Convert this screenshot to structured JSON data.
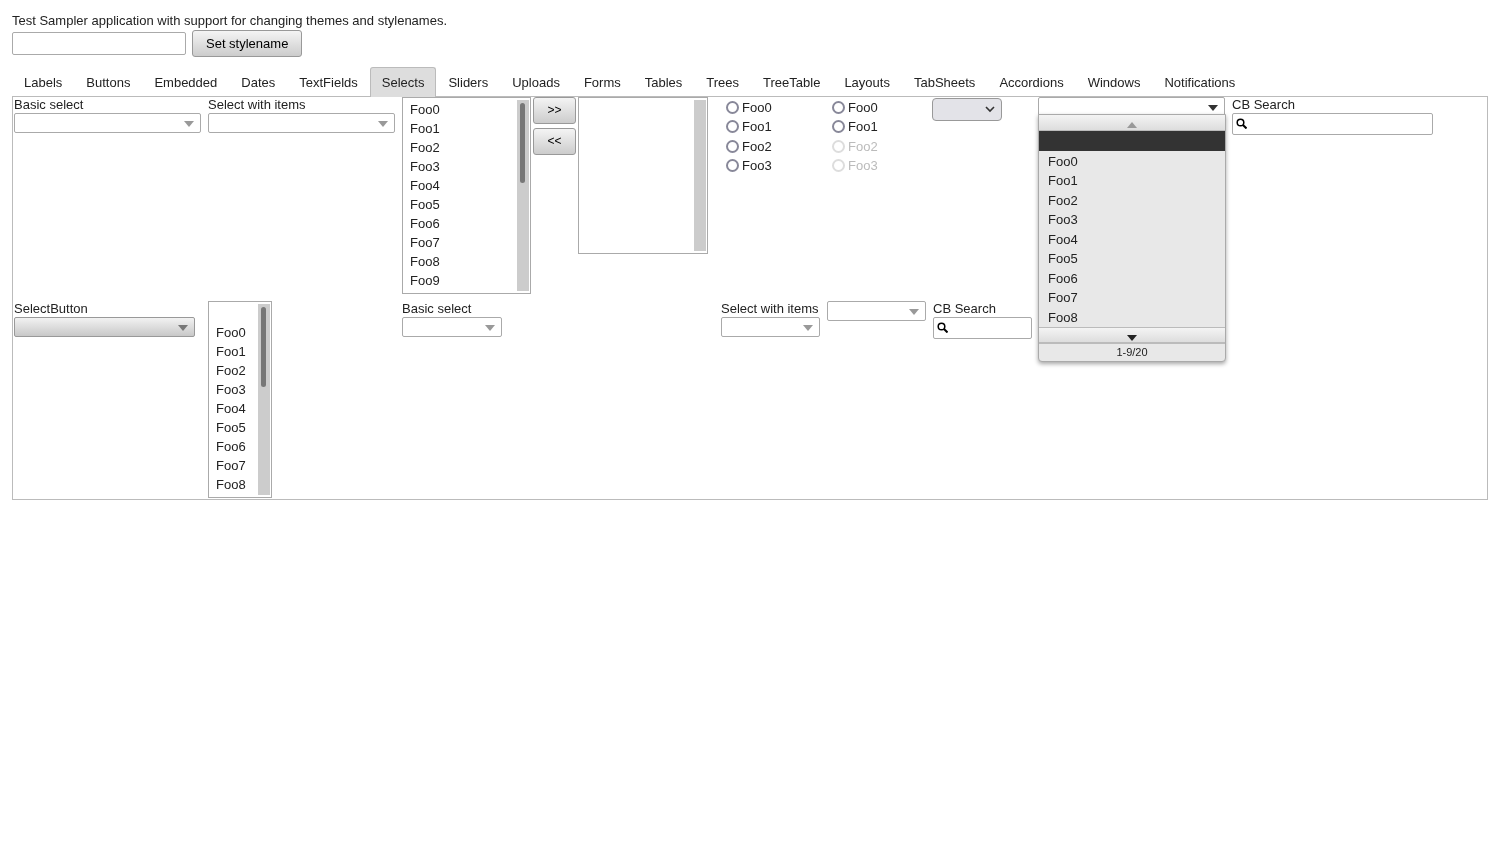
{
  "header": {
    "caption": "Test Sampler application with support for changing themes and stylenames.",
    "button": "Set stylename"
  },
  "tabs": [
    {
      "label": "Labels",
      "selected": false
    },
    {
      "label": "Buttons",
      "selected": false
    },
    {
      "label": "Embedded",
      "selected": false
    },
    {
      "label": "Dates",
      "selected": false
    },
    {
      "label": "TextFields",
      "selected": false
    },
    {
      "label": "Selects",
      "selected": true
    },
    {
      "label": "Sliders",
      "selected": false
    },
    {
      "label": "Uploads",
      "selected": false
    },
    {
      "label": "Forms",
      "selected": false
    },
    {
      "label": "Tables",
      "selected": false
    },
    {
      "label": "Trees",
      "selected": false
    },
    {
      "label": "TreeTable",
      "selected": false
    },
    {
      "label": "Layouts",
      "selected": false
    },
    {
      "label": "TabSheets",
      "selected": false
    },
    {
      "label": "Accordions",
      "selected": false
    },
    {
      "label": "Windows",
      "selected": false
    },
    {
      "label": "Notifications",
      "selected": false
    }
  ],
  "rows": [
    [
      {
        "kind": "select",
        "label": "Basic select"
      },
      {
        "kind": "select",
        "label": "Select with items"
      },
      {
        "kind": "listbox",
        "items": [
          "Foo0",
          "Foo1",
          "Foo2",
          "Foo3",
          "Foo4",
          "Foo5",
          "Foo6",
          "Foo7",
          "Foo8",
          "Foo9"
        ]
      },
      {
        "kind": "twin_buttons",
        "buttons": [
          ">>",
          "<<"
        ]
      },
      {
        "kind": "listbox"
      },
      {
        "kind": "radio_group",
        "options": [
          {
            "label": "Foo0",
            "selected": false,
            "disabled": false
          },
          {
            "label": "Foo1",
            "selected": false,
            "disabled": false
          },
          {
            "label": "Foo2",
            "selected": false,
            "disabled": false
          },
          {
            "label": "Foo3",
            "selected": false,
            "disabled": false
          }
        ]
      },
      {
        "kind": "radio_group",
        "options": [
          {
            "label": "Foo0",
            "selected": false,
            "disabled": false
          },
          {
            "label": "Foo1",
            "selected": false,
            "disabled": false
          },
          {
            "label": "Foo2",
            "selected": false,
            "disabled": true
          },
          {
            "label": "Foo3",
            "selected": false,
            "disabled": true
          }
        ]
      },
      {
        "kind": "native_select"
      },
      {
        "kind": "combo",
        "popup": {
          "empty_row_selected": true,
          "items": [
            "Foo0",
            "Foo1",
            "Foo2",
            "Foo3",
            "Foo4",
            "Foo5",
            "Foo6",
            "Foo7",
            "Foo8"
          ],
          "footer": "1-9/20"
        }
      },
      {
        "kind": "search",
        "label": "CB Search"
      }
    ],
    [
      {
        "kind": "select_button",
        "label": "SelectButton"
      },
      {
        "kind": "listbox",
        "leading_blank": true,
        "items": [
          "Foo0",
          "Foo1",
          "Foo2",
          "Foo3",
          "Foo4",
          "Foo5",
          "Foo6",
          "Foo7",
          "Foo8"
        ]
      },
      {
        "kind": "select",
        "label": "Basic select"
      },
      {
        "kind": "select",
        "label": "Select with items"
      },
      {
        "kind": "combo"
      },
      {
        "kind": "search",
        "label": "CB Search"
      }
    ]
  ]
}
